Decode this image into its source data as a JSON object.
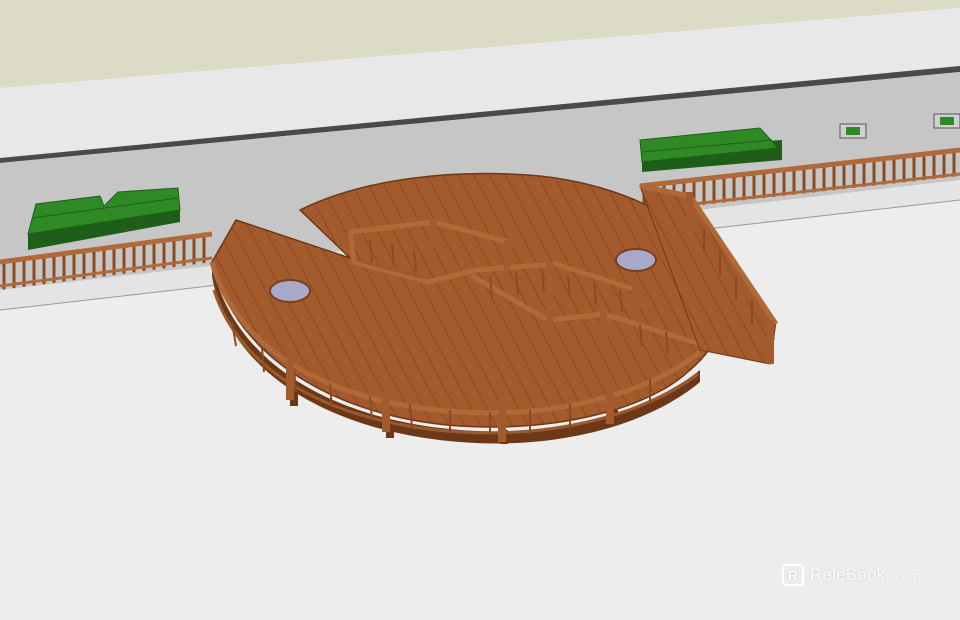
{
  "scene": {
    "description_free": true,
    "colors": {
      "ground": "#ededed",
      "back_lawn": "#dcdcc6",
      "road": "#c9c9c9",
      "sidewalk": "#e6e6e6",
      "curb": "#4a4a4a",
      "deck": "#a35a2c",
      "deck_dark": "#7a3f1e",
      "railing": "#b06a39",
      "hedge": "#2f8a26",
      "hedge_dark": "#1e5e18",
      "pool": "#a8a8c8"
    },
    "icons": [
      "relebook-logo-icon"
    ]
  },
  "watermark": {
    "brand": "ReleBook",
    "suffix": ".com"
  }
}
